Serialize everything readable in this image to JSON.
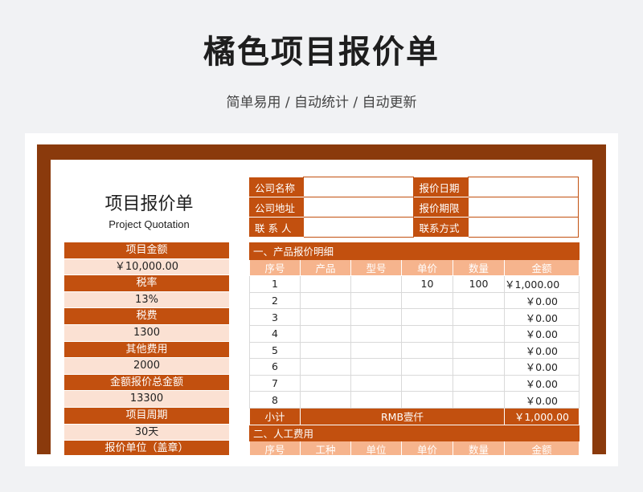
{
  "banner": {
    "title": "橘色项目报价单",
    "subtitle": "简单易用 / 自动统计 / 自动更新"
  },
  "doc": {
    "title": "项目报价单",
    "subtitle": "Project Quotation"
  },
  "summary": [
    {
      "label": "项目金额",
      "value": "￥10,000.00"
    },
    {
      "label": "税率",
      "value": "13%"
    },
    {
      "label": "税费",
      "value": "1300"
    },
    {
      "label": "其他费用",
      "value": "2000"
    },
    {
      "label": "金额报价总金额",
      "value": "13300"
    },
    {
      "label": "项目周期",
      "value": "30天"
    },
    {
      "label": "报价单位（盖章）",
      "value": ""
    }
  ],
  "info": {
    "company_name": "公司名称",
    "quote_date": "报价日期",
    "company_address": "公司地址",
    "quote_deadline": "报价期限",
    "contact": "联 系 人",
    "contact_method": "联系方式"
  },
  "products": {
    "section": "一、产品报价明细",
    "headers": [
      "序号",
      "产品",
      "型号",
      "单价",
      "数量",
      "金额"
    ],
    "rows": [
      [
        "1",
        "",
        "",
        "10",
        "100",
        "￥1,000.00"
      ],
      [
        "2",
        "",
        "",
        "",
        "",
        "￥0.00"
      ],
      [
        "3",
        "",
        "",
        "",
        "",
        "￥0.00"
      ],
      [
        "4",
        "",
        "",
        "",
        "",
        "￥0.00"
      ],
      [
        "5",
        "",
        "",
        "",
        "",
        "￥0.00"
      ],
      [
        "6",
        "",
        "",
        "",
        "",
        "￥0.00"
      ],
      [
        "7",
        "",
        "",
        "",
        "",
        "￥0.00"
      ],
      [
        "8",
        "",
        "",
        "",
        "",
        "￥0.00"
      ]
    ],
    "subtotal_label": "小计",
    "subtotal_words": "RMB壹仟",
    "subtotal_amount": "￥1,000.00"
  },
  "labor": {
    "section": "二、人工费用",
    "headers": [
      "序号",
      "工种",
      "单位",
      "单价",
      "数量",
      "金额"
    ]
  },
  "colors": {
    "accent": "#c2500f",
    "frame": "#8a3a0c",
    "header_light": "#f6b48d",
    "value_bg": "#fbe1d3"
  }
}
